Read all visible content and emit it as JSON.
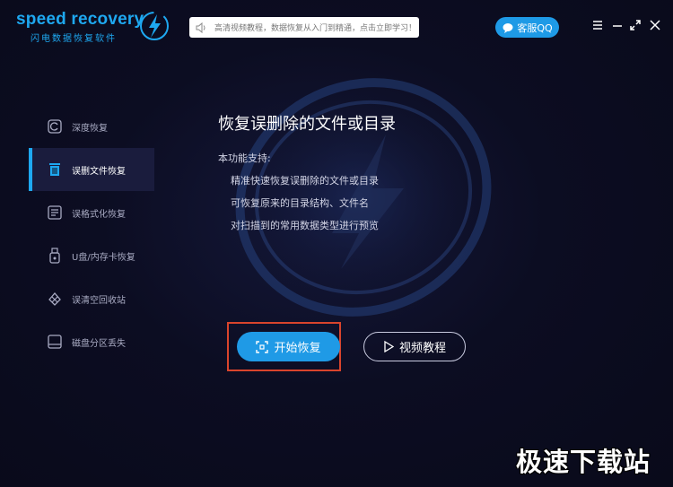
{
  "app": {
    "logo_text": "speed recovery",
    "logo_sub": "闪电数据恢复软件"
  },
  "titlebar": {
    "notice": "高清视频教程，数据恢复从入门到精通，点击立即学习！",
    "qq_label": "客服QQ"
  },
  "sidebar": {
    "items": [
      {
        "label": "深度恢复",
        "icon": "deep-scan-icon"
      },
      {
        "label": "误删文件恢复",
        "icon": "trash-icon"
      },
      {
        "label": "误格式化恢复",
        "icon": "format-disk-icon"
      },
      {
        "label": "U盘/内存卡恢复",
        "icon": "usb-icon"
      },
      {
        "label": "误清空回收站",
        "icon": "recycle-icon"
      },
      {
        "label": "磁盘分区丢失",
        "icon": "partition-icon"
      }
    ],
    "active_index": 1
  },
  "main": {
    "title": "恢复误删除的文件或目录",
    "support_label": "本功能支持:",
    "features": [
      "精准快速恢复误删除的文件或目录",
      "可恢复原来的目录结构、文件名",
      "对扫描到的常用数据类型进行预览"
    ],
    "start_button": "开始恢复",
    "video_button": "视频教程"
  },
  "watermark": "极速下载站",
  "colors": {
    "accent": "#1ea8f0",
    "button": "#1f9ae6",
    "background": "#0b0c1e",
    "highlight": "#d9442c"
  }
}
